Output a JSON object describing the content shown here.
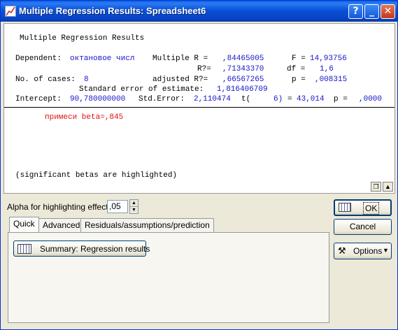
{
  "window": {
    "title": "Multiple Regression Results: Spreadsheet6"
  },
  "title_buttons": {
    "help": "?",
    "minimize": "_",
    "close": "✕"
  },
  "results": {
    "heading": "Multiple Regression Results",
    "dependent_label": "Dependent:",
    "dependent_value": "октановое числ",
    "multiple_r_label": "Multiple R =",
    "multiple_r_value": ",84465005",
    "f_label": "F =",
    "f_value": "14,93756",
    "r2_label": "R?=",
    "r2_value": ",71343370",
    "df_label": "df =",
    "df_value": "1,6",
    "cases_label": "No. of cases:",
    "cases_value": "8",
    "adj_r2_label": "adjusted R?=",
    "adj_r2_value": ",66567265",
    "p_label": "p =",
    "p_value": ",008315",
    "se_label": "Standard error of estimate:",
    "se_value": "1,816406709",
    "intercept_label": "Intercept:",
    "intercept_value": "90,780000000",
    "std_error_label": "Std.Error:",
    "std_error_value": "2,110474",
    "t_label": "t(",
    "t_df": "6)",
    "t_eq": "=",
    "t_value": "43,014",
    "p2_label": "p =",
    "p2_value": ",0000",
    "beta_line": "примеси beta=,845",
    "footnote": "(significant betas are highlighted)"
  },
  "alpha": {
    "label": "Alpha for highlighting effects:",
    "value": ",05"
  },
  "tabs": [
    {
      "label": "Quick"
    },
    {
      "label": "Advanced"
    },
    {
      "label": "Residuals/assumptions/prediction"
    }
  ],
  "summary_button": {
    "label": "Summary:  Regression results"
  },
  "buttons": {
    "ok": "OK",
    "cancel": "Cancel",
    "options": "Options"
  }
}
